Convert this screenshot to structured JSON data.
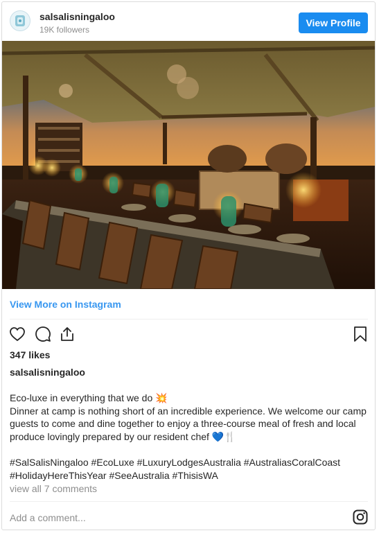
{
  "header": {
    "username": "salsalisningaloo",
    "followers": "19K followers",
    "view_profile_label": "View Profile"
  },
  "photo": {
    "subject": "candle-lit dining table under a canvas tent at dusk"
  },
  "view_more_label": "View More on Instagram",
  "actions": {
    "icons": [
      "heart-icon",
      "comment-icon",
      "share-icon",
      "bookmark-icon"
    ]
  },
  "likes": "347 likes",
  "caption": {
    "username": "salsalisningaloo",
    "line1": "Eco-luxe in everything that we do ",
    "line1_emoji": "💥",
    "body": "Dinner at camp is nothing short of an incredible experience. We welcome our camp guests to come and dine together to enjoy a three-course meal of fresh and local produce lovingly prepared by our resident chef ",
    "body_emoji": "💙🍴",
    "hashtags": "#SalSalisNingaloo #EcoLuxe #LuxuryLodgesAustralia #AustraliasCoralCoast #HolidayHereThisYear #SeeAustralia #ThisisWA"
  },
  "comments_link": "view all 7 comments",
  "add_comment_placeholder": "Add a comment...",
  "colors": {
    "accent": "#3897f0",
    "button": "#1a8cf0",
    "muted": "#8e8e8e",
    "text": "#262626"
  }
}
